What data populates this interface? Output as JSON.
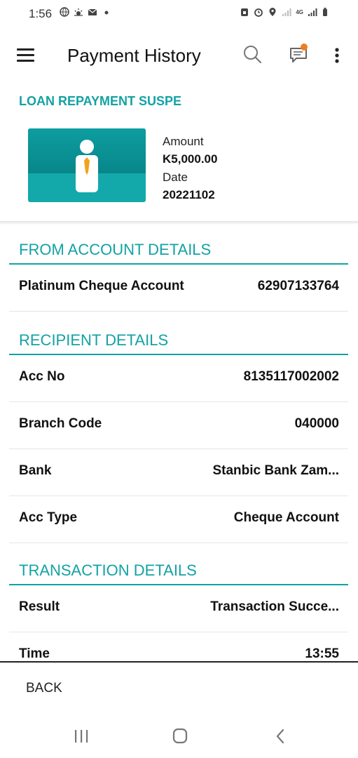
{
  "status_bar": {
    "time": "1:56",
    "network_label": "4G",
    "icons_left": [
      "browser-icon",
      "weather-icon",
      "mail-icon",
      "dot-icon"
    ],
    "icons_right": [
      "vpn-icon",
      "alarm-icon",
      "location-icon",
      "signal-icon",
      "signal-icon",
      "battery-icon"
    ]
  },
  "app_bar": {
    "title": "Payment History",
    "icons": [
      "menu-icon",
      "search-icon",
      "chat-icon",
      "more-vert-icon"
    ],
    "notification_color": "#f07e21"
  },
  "summary": {
    "title": "LOAN REPAYMENT SUSPE",
    "amount_label": "Amount",
    "amount_value": "K5,000.00",
    "date_label": "Date",
    "date_value": "20221102",
    "image_icon": "person-tie-icon"
  },
  "sections": {
    "from_account": {
      "heading": "FROM ACCOUNT DETAILS",
      "rows": [
        {
          "label": "Platinum Cheque Account",
          "value": "62907133764"
        }
      ]
    },
    "recipient": {
      "heading": "RECIPIENT DETAILS",
      "rows": [
        {
          "label": "Acc No",
          "value": "8135117002002"
        },
        {
          "label": "Branch Code",
          "value": "040000"
        },
        {
          "label": "Bank",
          "value": "Stanbic Bank Zam..."
        },
        {
          "label": "Acc Type",
          "value": "Cheque Account"
        }
      ]
    },
    "transaction": {
      "heading": "TRANSACTION DETAILS",
      "rows": [
        {
          "label": "Result",
          "value": "Transaction Succe..."
        },
        {
          "label": "Time",
          "value": "13:55"
        }
      ]
    }
  },
  "footer": {
    "back_label": "BACK"
  },
  "nav_bar": {
    "icons": [
      "recent-apps-icon",
      "home-icon",
      "back-icon"
    ]
  },
  "colors": {
    "accent": "#13a2a4",
    "text": "#111111"
  }
}
